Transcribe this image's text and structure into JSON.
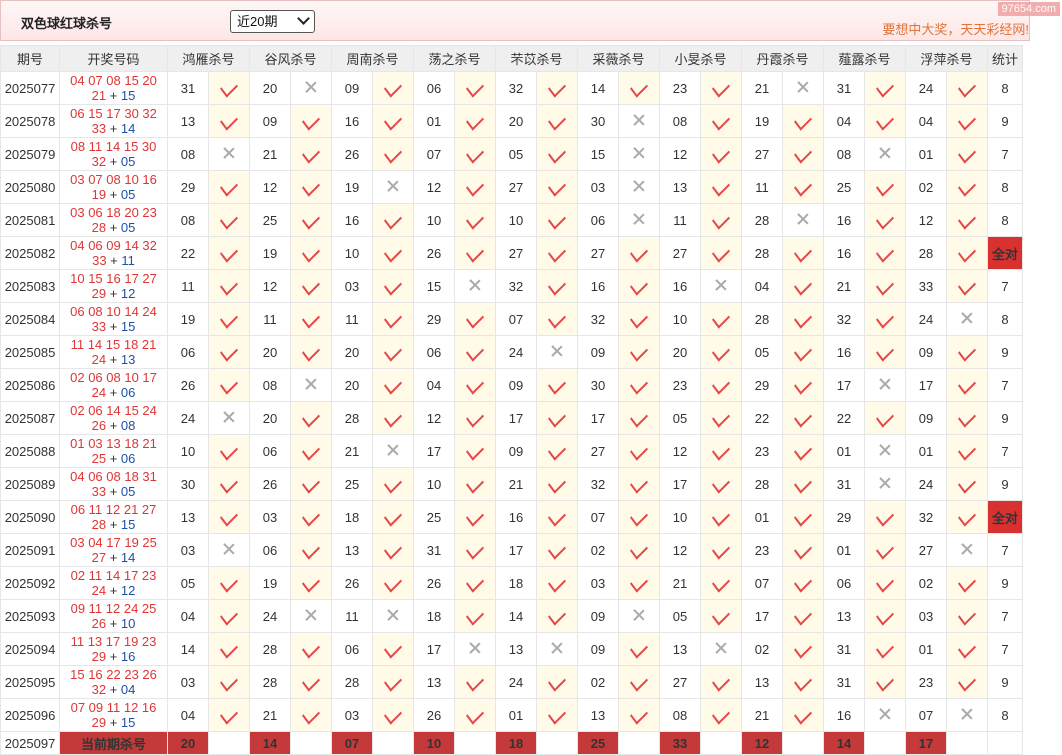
{
  "header": {
    "title": "双色球红球杀号",
    "period_selected": "近20期",
    "slogan": "要想中大奖，天天彩经网!",
    "watermark": "97654.com"
  },
  "columns": [
    "期号",
    "开奖号码",
    "鸿雁杀号",
    "谷风杀号",
    "周南杀号",
    "荡之杀号",
    "芣苡杀号",
    "采薇杀号",
    "小旻杀号",
    "丹霞杀号",
    "薤露杀号",
    "浮萍杀号",
    "统计"
  ],
  "rows": [
    {
      "issue": "2025077",
      "red1": "04 07 08 15 20",
      "red2": "21",
      "blue": "15",
      "kills": [
        [
          "31",
          1
        ],
        [
          "20",
          0
        ],
        [
          "09",
          1
        ],
        [
          "06",
          1
        ],
        [
          "32",
          1
        ],
        [
          "14",
          1
        ],
        [
          "23",
          1
        ],
        [
          "21",
          0
        ],
        [
          "31",
          1
        ],
        [
          "24",
          1
        ]
      ],
      "stat": "8"
    },
    {
      "issue": "2025078",
      "red1": "06 15 17 30 32",
      "red2": "33",
      "blue": "14",
      "kills": [
        [
          "13",
          1
        ],
        [
          "09",
          1
        ],
        [
          "16",
          1
        ],
        [
          "01",
          1
        ],
        [
          "20",
          1
        ],
        [
          "30",
          0
        ],
        [
          "08",
          1
        ],
        [
          "19",
          1
        ],
        [
          "04",
          1
        ],
        [
          "04",
          1
        ]
      ],
      "stat": "9"
    },
    {
      "issue": "2025079",
      "red1": "08 11 14 15 30",
      "red2": "32",
      "blue": "05",
      "kills": [
        [
          "08",
          0
        ],
        [
          "21",
          1
        ],
        [
          "26",
          1
        ],
        [
          "07",
          1
        ],
        [
          "05",
          1
        ],
        [
          "15",
          0
        ],
        [
          "12",
          1
        ],
        [
          "27",
          1
        ],
        [
          "08",
          0
        ],
        [
          "01",
          1
        ]
      ],
      "stat": "7"
    },
    {
      "issue": "2025080",
      "red1": "03 07 08 10 16",
      "red2": "19",
      "blue": "05",
      "kills": [
        [
          "29",
          1
        ],
        [
          "12",
          1
        ],
        [
          "19",
          0
        ],
        [
          "12",
          1
        ],
        [
          "27",
          1
        ],
        [
          "03",
          0
        ],
        [
          "13",
          1
        ],
        [
          "11",
          1
        ],
        [
          "25",
          1
        ],
        [
          "02",
          1
        ]
      ],
      "stat": "8"
    },
    {
      "issue": "2025081",
      "red1": "03 06 18 20 23",
      "red2": "28",
      "blue": "05",
      "kills": [
        [
          "08",
          1
        ],
        [
          "25",
          1
        ],
        [
          "16",
          1
        ],
        [
          "10",
          1
        ],
        [
          "10",
          1
        ],
        [
          "06",
          0
        ],
        [
          "11",
          1
        ],
        [
          "28",
          0
        ],
        [
          "16",
          1
        ],
        [
          "12",
          1
        ]
      ],
      "stat": "8"
    },
    {
      "issue": "2025082",
      "red1": "04 06 09 14 32",
      "red2": "33",
      "blue": "11",
      "kills": [
        [
          "22",
          1
        ],
        [
          "19",
          1
        ],
        [
          "10",
          1
        ],
        [
          "26",
          1
        ],
        [
          "27",
          1
        ],
        [
          "27",
          1
        ],
        [
          "27",
          1
        ],
        [
          "28",
          1
        ],
        [
          "16",
          1
        ],
        [
          "28",
          1
        ]
      ],
      "stat": "全对"
    },
    {
      "issue": "2025083",
      "red1": "10 15 16 17 27",
      "red2": "29",
      "blue": "12",
      "kills": [
        [
          "11",
          1
        ],
        [
          "12",
          1
        ],
        [
          "03",
          1
        ],
        [
          "15",
          0
        ],
        [
          "32",
          1
        ],
        [
          "16",
          1
        ],
        [
          "16",
          0
        ],
        [
          "04",
          1
        ],
        [
          "21",
          1
        ],
        [
          "33",
          1
        ]
      ],
      "stat": "7"
    },
    {
      "issue": "2025084",
      "red1": "06 08 10 14 24",
      "red2": "33",
      "blue": "15",
      "kills": [
        [
          "19",
          1
        ],
        [
          "11",
          1
        ],
        [
          "11",
          1
        ],
        [
          "29",
          1
        ],
        [
          "07",
          1
        ],
        [
          "32",
          1
        ],
        [
          "10",
          1
        ],
        [
          "28",
          1
        ],
        [
          "32",
          1
        ],
        [
          "24",
          0
        ]
      ],
      "stat": "8"
    },
    {
      "issue": "2025085",
      "red1": "11 14 15 18 21",
      "red2": "24",
      "blue": "13",
      "kills": [
        [
          "06",
          1
        ],
        [
          "20",
          1
        ],
        [
          "20",
          1
        ],
        [
          "06",
          1
        ],
        [
          "24",
          0
        ],
        [
          "09",
          1
        ],
        [
          "20",
          1
        ],
        [
          "05",
          1
        ],
        [
          "16",
          1
        ],
        [
          "09",
          1
        ]
      ],
      "stat": "9"
    },
    {
      "issue": "2025086",
      "red1": "02 06 08 10 17",
      "red2": "24",
      "blue": "06",
      "kills": [
        [
          "26",
          1
        ],
        [
          "08",
          0
        ],
        [
          "20",
          1
        ],
        [
          "04",
          1
        ],
        [
          "09",
          1
        ],
        [
          "30",
          1
        ],
        [
          "23",
          1
        ],
        [
          "29",
          1
        ],
        [
          "17",
          0
        ],
        [
          "17",
          1
        ]
      ],
      "stat": "7"
    },
    {
      "issue": "2025087",
      "red1": "02 06 14 15 24",
      "red2": "26",
      "blue": "08",
      "kills": [
        [
          "24",
          0
        ],
        [
          "20",
          1
        ],
        [
          "28",
          1
        ],
        [
          "12",
          1
        ],
        [
          "17",
          1
        ],
        [
          "17",
          1
        ],
        [
          "05",
          1
        ],
        [
          "22",
          1
        ],
        [
          "22",
          1
        ],
        [
          "09",
          1
        ]
      ],
      "stat": "9"
    },
    {
      "issue": "2025088",
      "red1": "01 03 13 18 21",
      "red2": "25",
      "blue": "06",
      "kills": [
        [
          "10",
          1
        ],
        [
          "06",
          1
        ],
        [
          "21",
          0
        ],
        [
          "17",
          1
        ],
        [
          "09",
          1
        ],
        [
          "27",
          1
        ],
        [
          "12",
          1
        ],
        [
          "23",
          1
        ],
        [
          "01",
          0
        ],
        [
          "01",
          1
        ]
      ],
      "stat": "7"
    },
    {
      "issue": "2025089",
      "red1": "04 06 08 18 31",
      "red2": "33",
      "blue": "05",
      "kills": [
        [
          "30",
          1
        ],
        [
          "26",
          1
        ],
        [
          "25",
          1
        ],
        [
          "10",
          1
        ],
        [
          "21",
          1
        ],
        [
          "32",
          1
        ],
        [
          "17",
          1
        ],
        [
          "28",
          1
        ],
        [
          "31",
          0
        ],
        [
          "24",
          1
        ]
      ],
      "stat": "9"
    },
    {
      "issue": "2025090",
      "red1": "06 11 12 21 27",
      "red2": "28",
      "blue": "15",
      "kills": [
        [
          "13",
          1
        ],
        [
          "03",
          1
        ],
        [
          "18",
          1
        ],
        [
          "25",
          1
        ],
        [
          "16",
          1
        ],
        [
          "07",
          1
        ],
        [
          "10",
          1
        ],
        [
          "01",
          1
        ],
        [
          "29",
          1
        ],
        [
          "32",
          1
        ]
      ],
      "stat": "全对"
    },
    {
      "issue": "2025091",
      "red1": "03 04 17 19 25",
      "red2": "27",
      "blue": "14",
      "kills": [
        [
          "03",
          0
        ],
        [
          "06",
          1
        ],
        [
          "13",
          1
        ],
        [
          "31",
          1
        ],
        [
          "17",
          1
        ],
        [
          "02",
          1
        ],
        [
          "12",
          1
        ],
        [
          "23",
          1
        ],
        [
          "01",
          1
        ],
        [
          "27",
          0
        ]
      ],
      "stat": "7"
    },
    {
      "issue": "2025092",
      "red1": "02 11 14 17 23",
      "red2": "24",
      "blue": "12",
      "kills": [
        [
          "05",
          1
        ],
        [
          "19",
          1
        ],
        [
          "26",
          1
        ],
        [
          "26",
          1
        ],
        [
          "18",
          1
        ],
        [
          "03",
          1
        ],
        [
          "21",
          1
        ],
        [
          "07",
          1
        ],
        [
          "06",
          1
        ],
        [
          "02",
          1
        ]
      ],
      "stat": "9"
    },
    {
      "issue": "2025093",
      "red1": "09 11 12 24 25",
      "red2": "26",
      "blue": "10",
      "kills": [
        [
          "04",
          1
        ],
        [
          "24",
          0
        ],
        [
          "11",
          0
        ],
        [
          "18",
          1
        ],
        [
          "14",
          1
        ],
        [
          "09",
          0
        ],
        [
          "05",
          1
        ],
        [
          "17",
          1
        ],
        [
          "13",
          1
        ],
        [
          "03",
          1
        ]
      ],
      "stat": "7"
    },
    {
      "issue": "2025094",
      "red1": "11 13 17 19 23",
      "red2": "29",
      "blue": "16",
      "kills": [
        [
          "14",
          1
        ],
        [
          "28",
          1
        ],
        [
          "06",
          1
        ],
        [
          "17",
          0
        ],
        [
          "13",
          0
        ],
        [
          "09",
          1
        ],
        [
          "13",
          0
        ],
        [
          "02",
          1
        ],
        [
          "31",
          1
        ],
        [
          "01",
          1
        ]
      ],
      "stat": "7"
    },
    {
      "issue": "2025095",
      "red1": "15 16 22 23 26",
      "red2": "32",
      "blue": "04",
      "kills": [
        [
          "03",
          1
        ],
        [
          "28",
          1
        ],
        [
          "28",
          1
        ],
        [
          "13",
          1
        ],
        [
          "24",
          1
        ],
        [
          "02",
          1
        ],
        [
          "27",
          1
        ],
        [
          "13",
          1
        ],
        [
          "31",
          1
        ],
        [
          "23",
          1
        ]
      ],
      "stat": "9"
    },
    {
      "issue": "2025096",
      "red1": "07 09 11 12 16",
      "red2": "29",
      "blue": "15",
      "kills": [
        [
          "04",
          1
        ],
        [
          "21",
          1
        ],
        [
          "03",
          1
        ],
        [
          "26",
          1
        ],
        [
          "01",
          1
        ],
        [
          "13",
          1
        ],
        [
          "08",
          1
        ],
        [
          "21",
          1
        ],
        [
          "16",
          0
        ],
        [
          "07",
          0
        ]
      ],
      "stat": "8"
    }
  ],
  "current": {
    "issue": "2025097",
    "label": "当前期杀号",
    "kills": [
      "20",
      "14",
      "07",
      "10",
      "18",
      "25",
      "33",
      "12",
      "14",
      "17"
    ]
  }
}
